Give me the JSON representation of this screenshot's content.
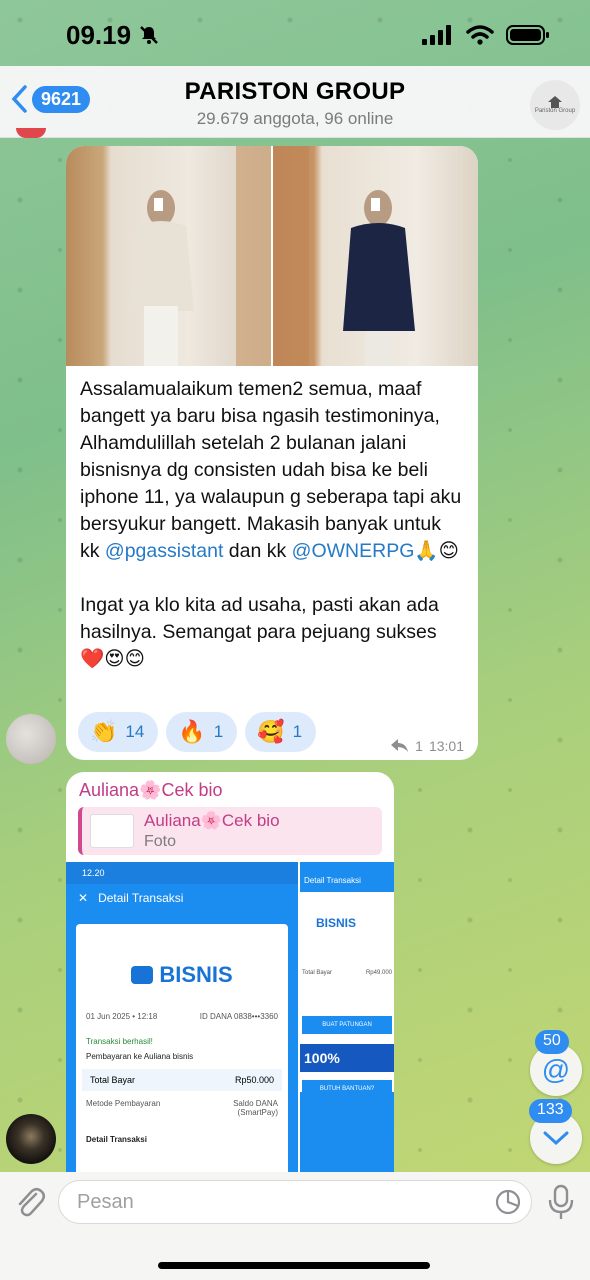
{
  "status_bar": {
    "time": "09.19"
  },
  "header": {
    "back_count": "9621",
    "title": "PARISTON GROUP",
    "subtitle": "29.679 anggota, 96 online",
    "avatar_text": "Pariston Group"
  },
  "message1": {
    "paragraph1_parts": [
      "Assalamualaikum temen2 semua, maaf bangett ya baru bisa ngasih testimoninya, Alhamdulillah setelah 2 bulanan jalani bisnisnya dg consisten udah bisa ke beli iphone 11, ya walaupun g seberapa tapi aku bersyukur bangett. Makasih banyak untuk kk ",
      "@pgassistant",
      " dan kk ",
      "@OWNERPG",
      "🙏😊"
    ],
    "paragraph2": "Ingat ya klo kita ad usaha, pasti akan ada hasilnya. Semangat para pejuang sukses ❤️😍😊",
    "reactions": [
      {
        "emoji": "👏",
        "count": "14"
      },
      {
        "emoji": "🔥",
        "count": "1"
      },
      {
        "emoji": "🥰",
        "count": "1"
      }
    ],
    "reply_count": "1",
    "time": "13:01"
  },
  "message2": {
    "sender": "Auliana🌸Cek bio",
    "reply_name": "Auliana🌸Cek bio",
    "reply_sub": "Foto",
    "screenshot": {
      "status_time": "12.20",
      "top_title": "Detail Transaksi",
      "brand": "BISNIS",
      "date": "01 Jun 2025 • 12:18",
      "dana_id": "ID DANA 0838•••3360",
      "status": "Transaksi berhasil!",
      "payee": "Pembayaran ke Auliana bisnis",
      "total_label": "Total Bayar",
      "total_value": "Rp50.000",
      "method_label": "Metode Pembayaran",
      "method_value": "Saldo DANA (SmartPay)",
      "detail_label": "Detail Transaksi"
    },
    "side_screenshot": {
      "title": "Detail Transaksi",
      "brand": "BISNIS",
      "total_label": "Total Bayar",
      "total_value": "Rp49.000",
      "button": "BUAT PATUNGAN",
      "promo": "100%",
      "help": "BUTUH BANTUAN?"
    }
  },
  "fab": {
    "mention_count": "50",
    "unread_count": "133"
  },
  "input": {
    "placeholder": "Pesan"
  }
}
